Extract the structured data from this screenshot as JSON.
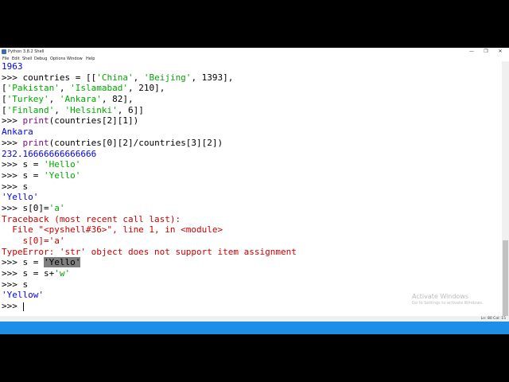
{
  "window": {
    "title": "Python 3.8.2 Shell",
    "controls": {
      "minimize": "—",
      "maximize": "❐",
      "close": "✕"
    }
  },
  "menubar": [
    "File",
    "Edit",
    "Shell",
    "Debug",
    "Options",
    "Window",
    "Help"
  ],
  "shell": {
    "lines": [
      [
        {
          "t": "1963",
          "c": "out"
        }
      ],
      [
        {
          "t": ">>> ",
          "c": "prompt"
        },
        {
          "t": "countries = [[",
          "c": "code"
        },
        {
          "t": "'China'",
          "c": "str"
        },
        {
          "t": ", ",
          "c": "code"
        },
        {
          "t": "'Beijing'",
          "c": "str"
        },
        {
          "t": ", 1393],",
          "c": "code"
        }
      ],
      [
        {
          "t": "[",
          "c": "code"
        },
        {
          "t": "'Pakistan'",
          "c": "str"
        },
        {
          "t": ", ",
          "c": "code"
        },
        {
          "t": "'Islamabad'",
          "c": "str"
        },
        {
          "t": ", 210],",
          "c": "code"
        }
      ],
      [
        {
          "t": "[",
          "c": "code"
        },
        {
          "t": "'Turkey'",
          "c": "str"
        },
        {
          "t": ", ",
          "c": "code"
        },
        {
          "t": "'Ankara'",
          "c": "str"
        },
        {
          "t": ", 82],",
          "c": "code"
        }
      ],
      [
        {
          "t": "[",
          "c": "code"
        },
        {
          "t": "'Finland'",
          "c": "str"
        },
        {
          "t": ", ",
          "c": "code"
        },
        {
          "t": "'Helsinki'",
          "c": "str"
        },
        {
          "t": ", 6]]",
          "c": "code"
        }
      ],
      [
        {
          "t": ">>> ",
          "c": "prompt"
        },
        {
          "t": "print",
          "c": "builtin"
        },
        {
          "t": "(countries[2][1])",
          "c": "code"
        }
      ],
      [
        {
          "t": "Ankara",
          "c": "out"
        }
      ],
      [
        {
          "t": ">>> ",
          "c": "prompt"
        },
        {
          "t": "print",
          "c": "builtin"
        },
        {
          "t": "(countries[0][2]/countries[3][2])",
          "c": "code"
        }
      ],
      [
        {
          "t": "232.16666666666666",
          "c": "out"
        }
      ],
      [
        {
          "t": ">>> ",
          "c": "prompt"
        },
        {
          "t": "s = ",
          "c": "code"
        },
        {
          "t": "'Hello'",
          "c": "str"
        }
      ],
      [
        {
          "t": ">>> ",
          "c": "prompt"
        },
        {
          "t": "s = ",
          "c": "code"
        },
        {
          "t": "'Yello'",
          "c": "str"
        }
      ],
      [
        {
          "t": ">>> ",
          "c": "prompt"
        },
        {
          "t": "s",
          "c": "code"
        }
      ],
      [
        {
          "t": "'Yello'",
          "c": "out"
        }
      ],
      [
        {
          "t": ">>> ",
          "c": "prompt"
        },
        {
          "t": "s[0]=",
          "c": "code"
        },
        {
          "t": "'a'",
          "c": "str"
        }
      ],
      [
        {
          "t": "Traceback (most recent call last):",
          "c": "err"
        }
      ],
      [
        {
          "t": "  File \"<pyshell#36>\", line 1, in <module>",
          "c": "err"
        }
      ],
      [
        {
          "t": "    s[0]='a'",
          "c": "err"
        }
      ],
      [
        {
          "t": "TypeError: 'str' object does not support item assignment",
          "c": "err"
        }
      ],
      [
        {
          "t": ">>> ",
          "c": "prompt"
        },
        {
          "t": "s = ",
          "c": "code"
        },
        {
          "t": "'Yello'",
          "c": "sel"
        }
      ],
      [
        {
          "t": ">>> ",
          "c": "prompt"
        },
        {
          "t": "s = s+",
          "c": "code"
        },
        {
          "t": "'w'",
          "c": "str"
        }
      ],
      [
        {
          "t": ">>> ",
          "c": "prompt"
        },
        {
          "t": "s",
          "c": "code"
        }
      ],
      [
        {
          "t": "'Yellow'",
          "c": "out"
        }
      ],
      [
        {
          "t": ">>> ",
          "c": "prompt"
        },
        {
          "t": "",
          "c": "cursor"
        }
      ]
    ]
  },
  "statusbar": {
    "position": "Ln: 80   Col: 15"
  },
  "watermark": {
    "title": "Activate Windows",
    "subtitle": "Go to Settings to activate Windows."
  },
  "colors": {
    "prompt": "#000000",
    "output": "#0000ff",
    "string": "#00aa00",
    "builtin": "#900090",
    "error": "#cc0000",
    "taskbar": "#1e8fe6"
  }
}
